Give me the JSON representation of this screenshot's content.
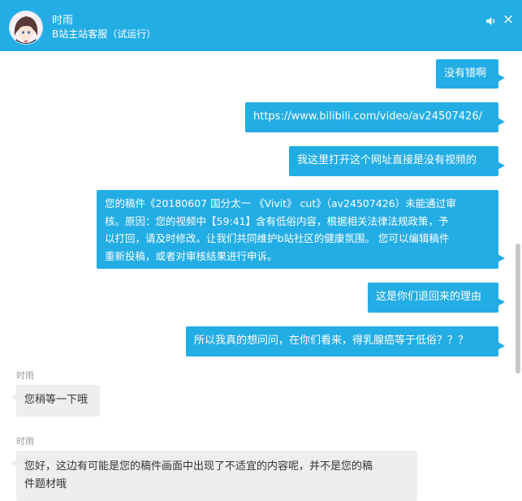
{
  "header": {
    "name": "时雨",
    "subtitle": "B站主站客服（试运行）"
  },
  "messages": [
    {
      "from": "me",
      "text": "没有错啊"
    },
    {
      "from": "me",
      "text": "https://www.bilibili.com/video/av24507426/"
    },
    {
      "from": "me",
      "text": "我这里打开这个网址直接是没有视频的"
    },
    {
      "from": "me",
      "lines": [
        "您的稿件《20180607 国分太一 《Vivit》 cut》（av24507426）未能通过审",
        "核。原因：您的视频中【59:41】含有低俗内容，根据相关法律法规政策，予",
        "以打回，请及时修改。让我们共同维护b站社区的健康氛围。 您可以编辑稿件",
        "重新投稿，或者对审核结果进行申诉。"
      ]
    },
    {
      "from": "me",
      "text": "这是你们退回来的理由"
    },
    {
      "from": "me",
      "text": "所以我真的想问问，在你们看来，得乳腺癌等于低俗？？？"
    },
    {
      "from": "them",
      "sender": "时雨",
      "text": "您稍等一下哦"
    },
    {
      "from": "them",
      "sender": "时雨",
      "lines": [
        "您好，这边有可能是您的稿件画面中出现了不适宜的内容呢，并不是您的稿",
        "件题材哦"
      ]
    }
  ],
  "colors": {
    "header": "#23ade5",
    "my_bubble": "#23ade5",
    "their_bubble": "#eeeeee",
    "sender_label": "#999999"
  },
  "icons": {
    "avatar": "anime-girl-avatar",
    "sound": "speaker-icon",
    "close": "close-icon"
  }
}
